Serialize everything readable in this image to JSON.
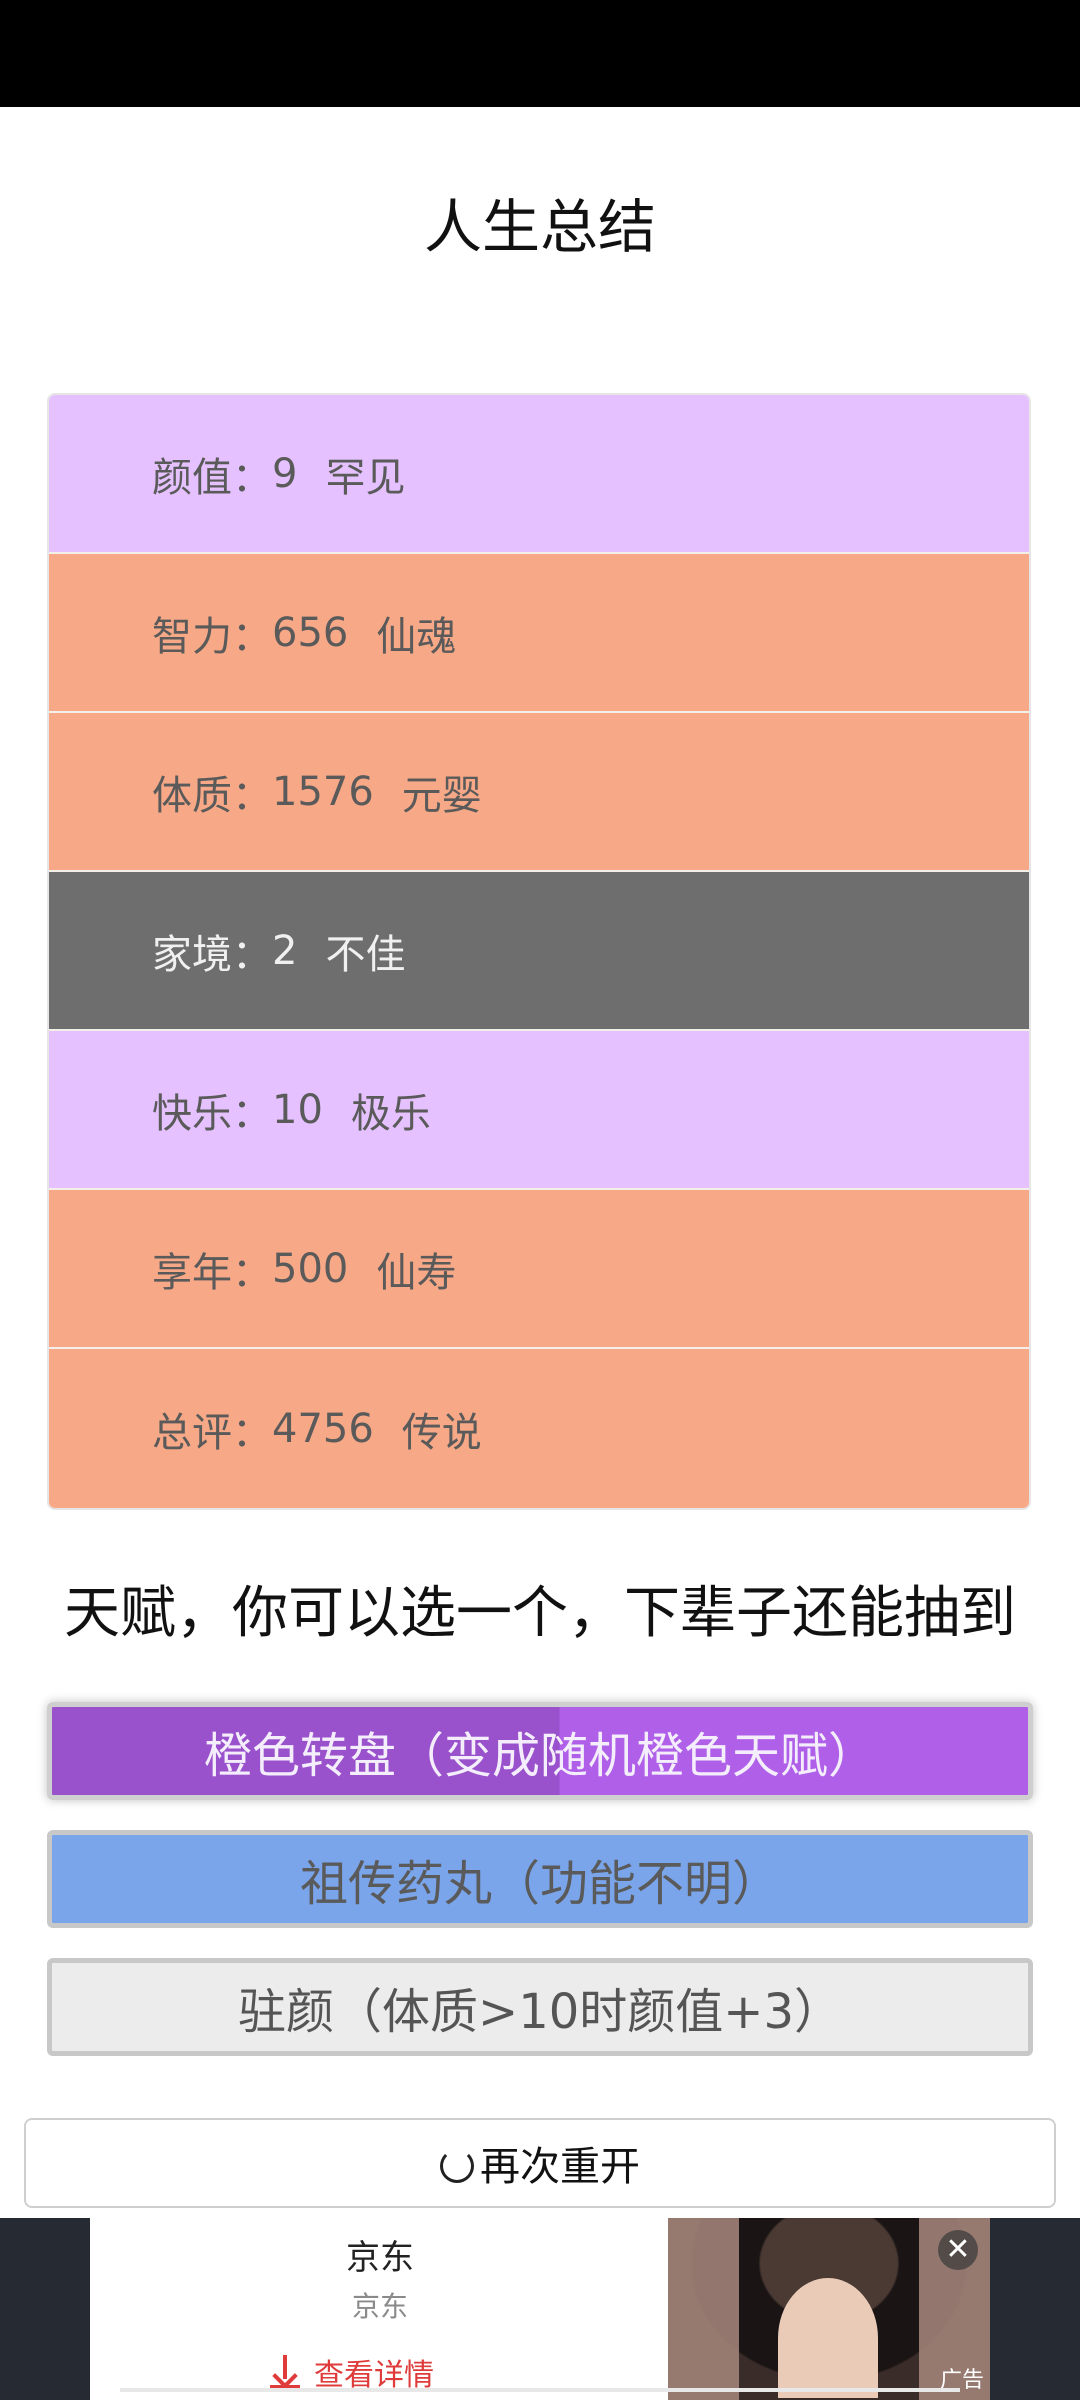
{
  "page": {
    "title": "人生总结"
  },
  "stats": [
    {
      "label": "颜值：",
      "value": "9",
      "grade": "罕见",
      "color": "#e5c2ff"
    },
    {
      "label": "智力：",
      "value": "656",
      "grade": "仙魂",
      "color": "#f6a887"
    },
    {
      "label": "体质：",
      "value": "1576",
      "grade": "元婴",
      "color": "#f6a887"
    },
    {
      "label": "家境：",
      "value": "2",
      "grade": "不佳",
      "color": "#6e6e6e"
    },
    {
      "label": "快乐：",
      "value": "10",
      "grade": "极乐",
      "color": "#e5c2ff"
    },
    {
      "label": "享年：",
      "value": "500",
      "grade": "仙寿",
      "color": "#f6a887"
    },
    {
      "label": "总评：",
      "value": "4756",
      "grade": "传说",
      "color": "#f6a887"
    }
  ],
  "talents": {
    "heading": "天赋，你可以选一个，下辈子还能抽到",
    "options": [
      {
        "label": "橙色转盘（变成随机橙色天赋）",
        "selected": true
      },
      {
        "label": "祖传药丸（功能不明）",
        "selected": false
      },
      {
        "label": "驻颜（体质>10时颜值+3）",
        "selected": false
      }
    ]
  },
  "restart": {
    "label": "再次重开",
    "icon": "refresh-icon"
  },
  "ad": {
    "title": "京东",
    "subtitle": "京东",
    "link_label": "查看详情",
    "tag": "广告",
    "close_icon": "close-icon"
  }
}
